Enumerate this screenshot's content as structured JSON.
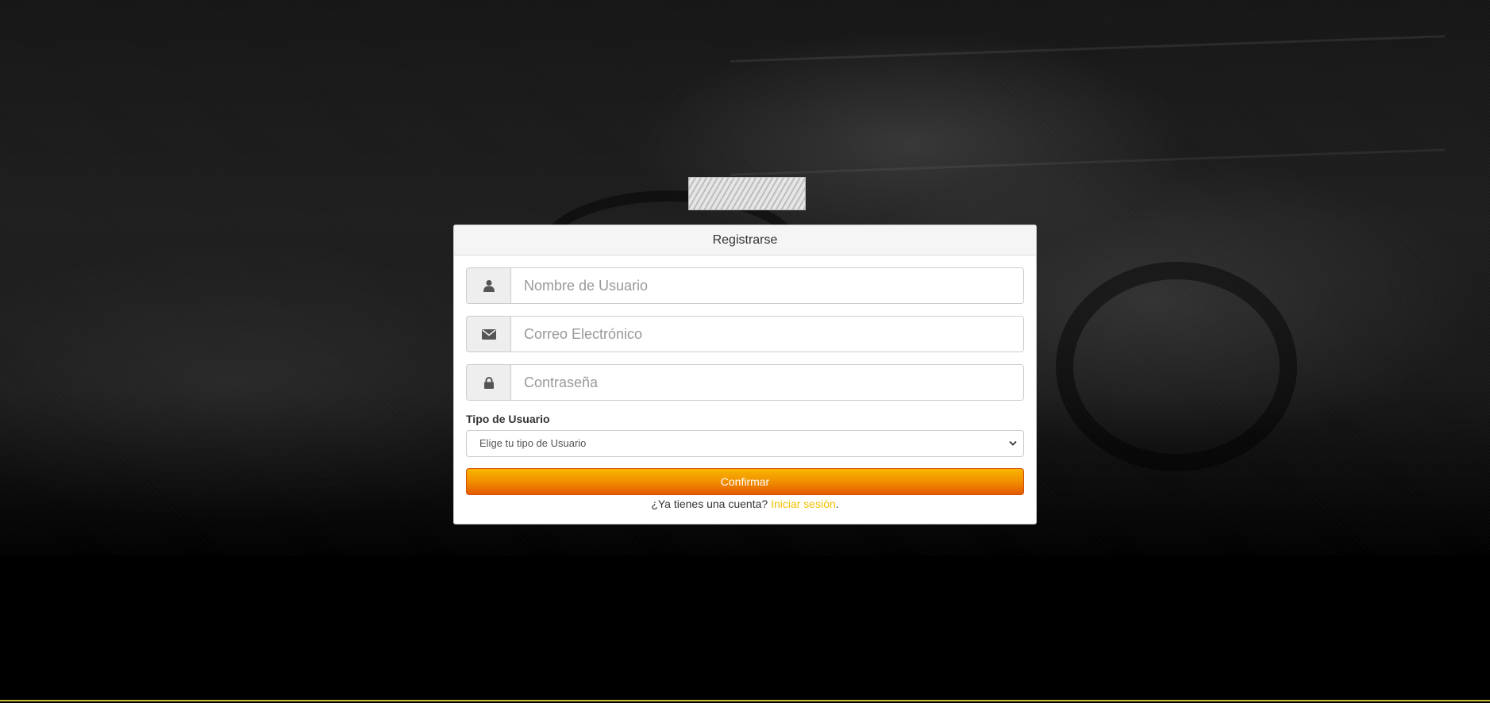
{
  "card": {
    "title": "Registrarse"
  },
  "form": {
    "username": {
      "placeholder": "Nombre de Usuario",
      "value": "",
      "icon": "user-icon"
    },
    "email": {
      "placeholder": "Correo Electrónico",
      "value": "",
      "icon": "envelope-icon"
    },
    "password": {
      "placeholder": "Contraseña",
      "value": "",
      "icon": "lock-icon"
    },
    "user_type": {
      "label": "Tipo de Usuario",
      "selected": "Elige tu tipo de Usuario"
    },
    "confirm_label": "Confirmar"
  },
  "footer": {
    "question": "¿Ya tienes una cuenta?",
    "login_link": "Iniciar sesión",
    "trailing": "."
  },
  "colors": {
    "accent": "#f4c000",
    "button_top": "#f8b500",
    "button_bottom": "#e35a00"
  }
}
